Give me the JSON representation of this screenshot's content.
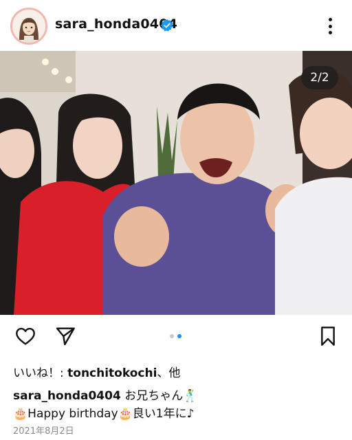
{
  "post": {
    "username": "sara_honda0404",
    "verified": true,
    "slide_counter": "2/2",
    "carousel": {
      "total": 2,
      "current": 2
    },
    "likes": {
      "prefix": "いいね！: ",
      "user": "tonchitokochi",
      "suffix": "、他"
    },
    "caption": {
      "username": "sara_honda0404",
      "line1": " お兄ちゃん",
      "line1_emoji": "🕺",
      "line2": "🎂Happy  birthday🎂良い1年に♪"
    },
    "date": "2021年8月2日"
  },
  "icons": {
    "more": "more-vertical-icon",
    "like": "heart-icon",
    "share": "send-icon",
    "save": "bookmark-icon",
    "verified": "verified-badge-icon"
  },
  "colors": {
    "verified": "#1d9bf0",
    "carousel_active": "#1d8ff0",
    "carousel_inactive": "#c8c8c8",
    "avatar_ring": "#f0b7b0"
  }
}
